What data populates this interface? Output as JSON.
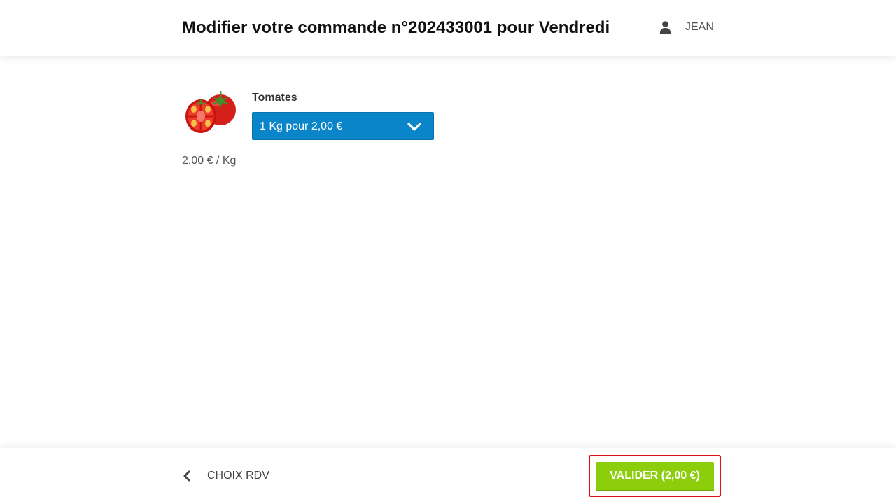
{
  "header": {
    "title": "Modifier votre commande n°202433001 pour Vendredi",
    "user_name": "JEAN",
    "user_icon": "user-icon"
  },
  "product": {
    "name": "Tomates",
    "image": "tomatoes-image",
    "quantity_select": {
      "selected": "1 Kg pour 2,00 €",
      "icon": "chevron-down-icon"
    },
    "unit_price": "2,00 € / Kg"
  },
  "footer": {
    "back_label": "CHOIX RDV",
    "back_icon": "chevron-left-icon",
    "validate_label": "VALIDER (2,00 €)"
  },
  "colors": {
    "select_background": "#0a85c9",
    "validate_background": "#8dce0c",
    "highlight_outline": "#e01010"
  }
}
